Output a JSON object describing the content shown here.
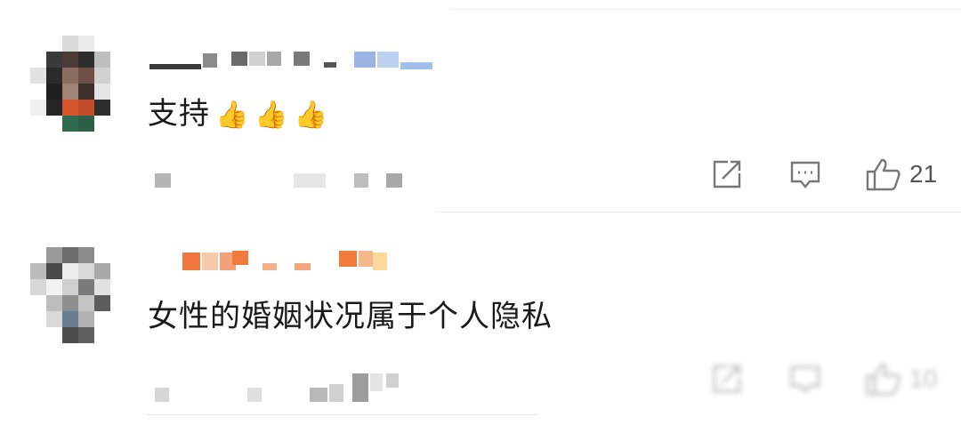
{
  "comments": [
    {
      "text": "支持",
      "emoji": [
        "👍",
        "👍",
        "👍"
      ],
      "likes": "21",
      "icons": [
        "share-icon",
        "reply-icon",
        "like-icon"
      ]
    },
    {
      "text": "女性的婚姻状况属于个人隐私",
      "likes": "10",
      "icons": [
        "share-icon",
        "reply-icon",
        "like-icon"
      ]
    }
  ]
}
